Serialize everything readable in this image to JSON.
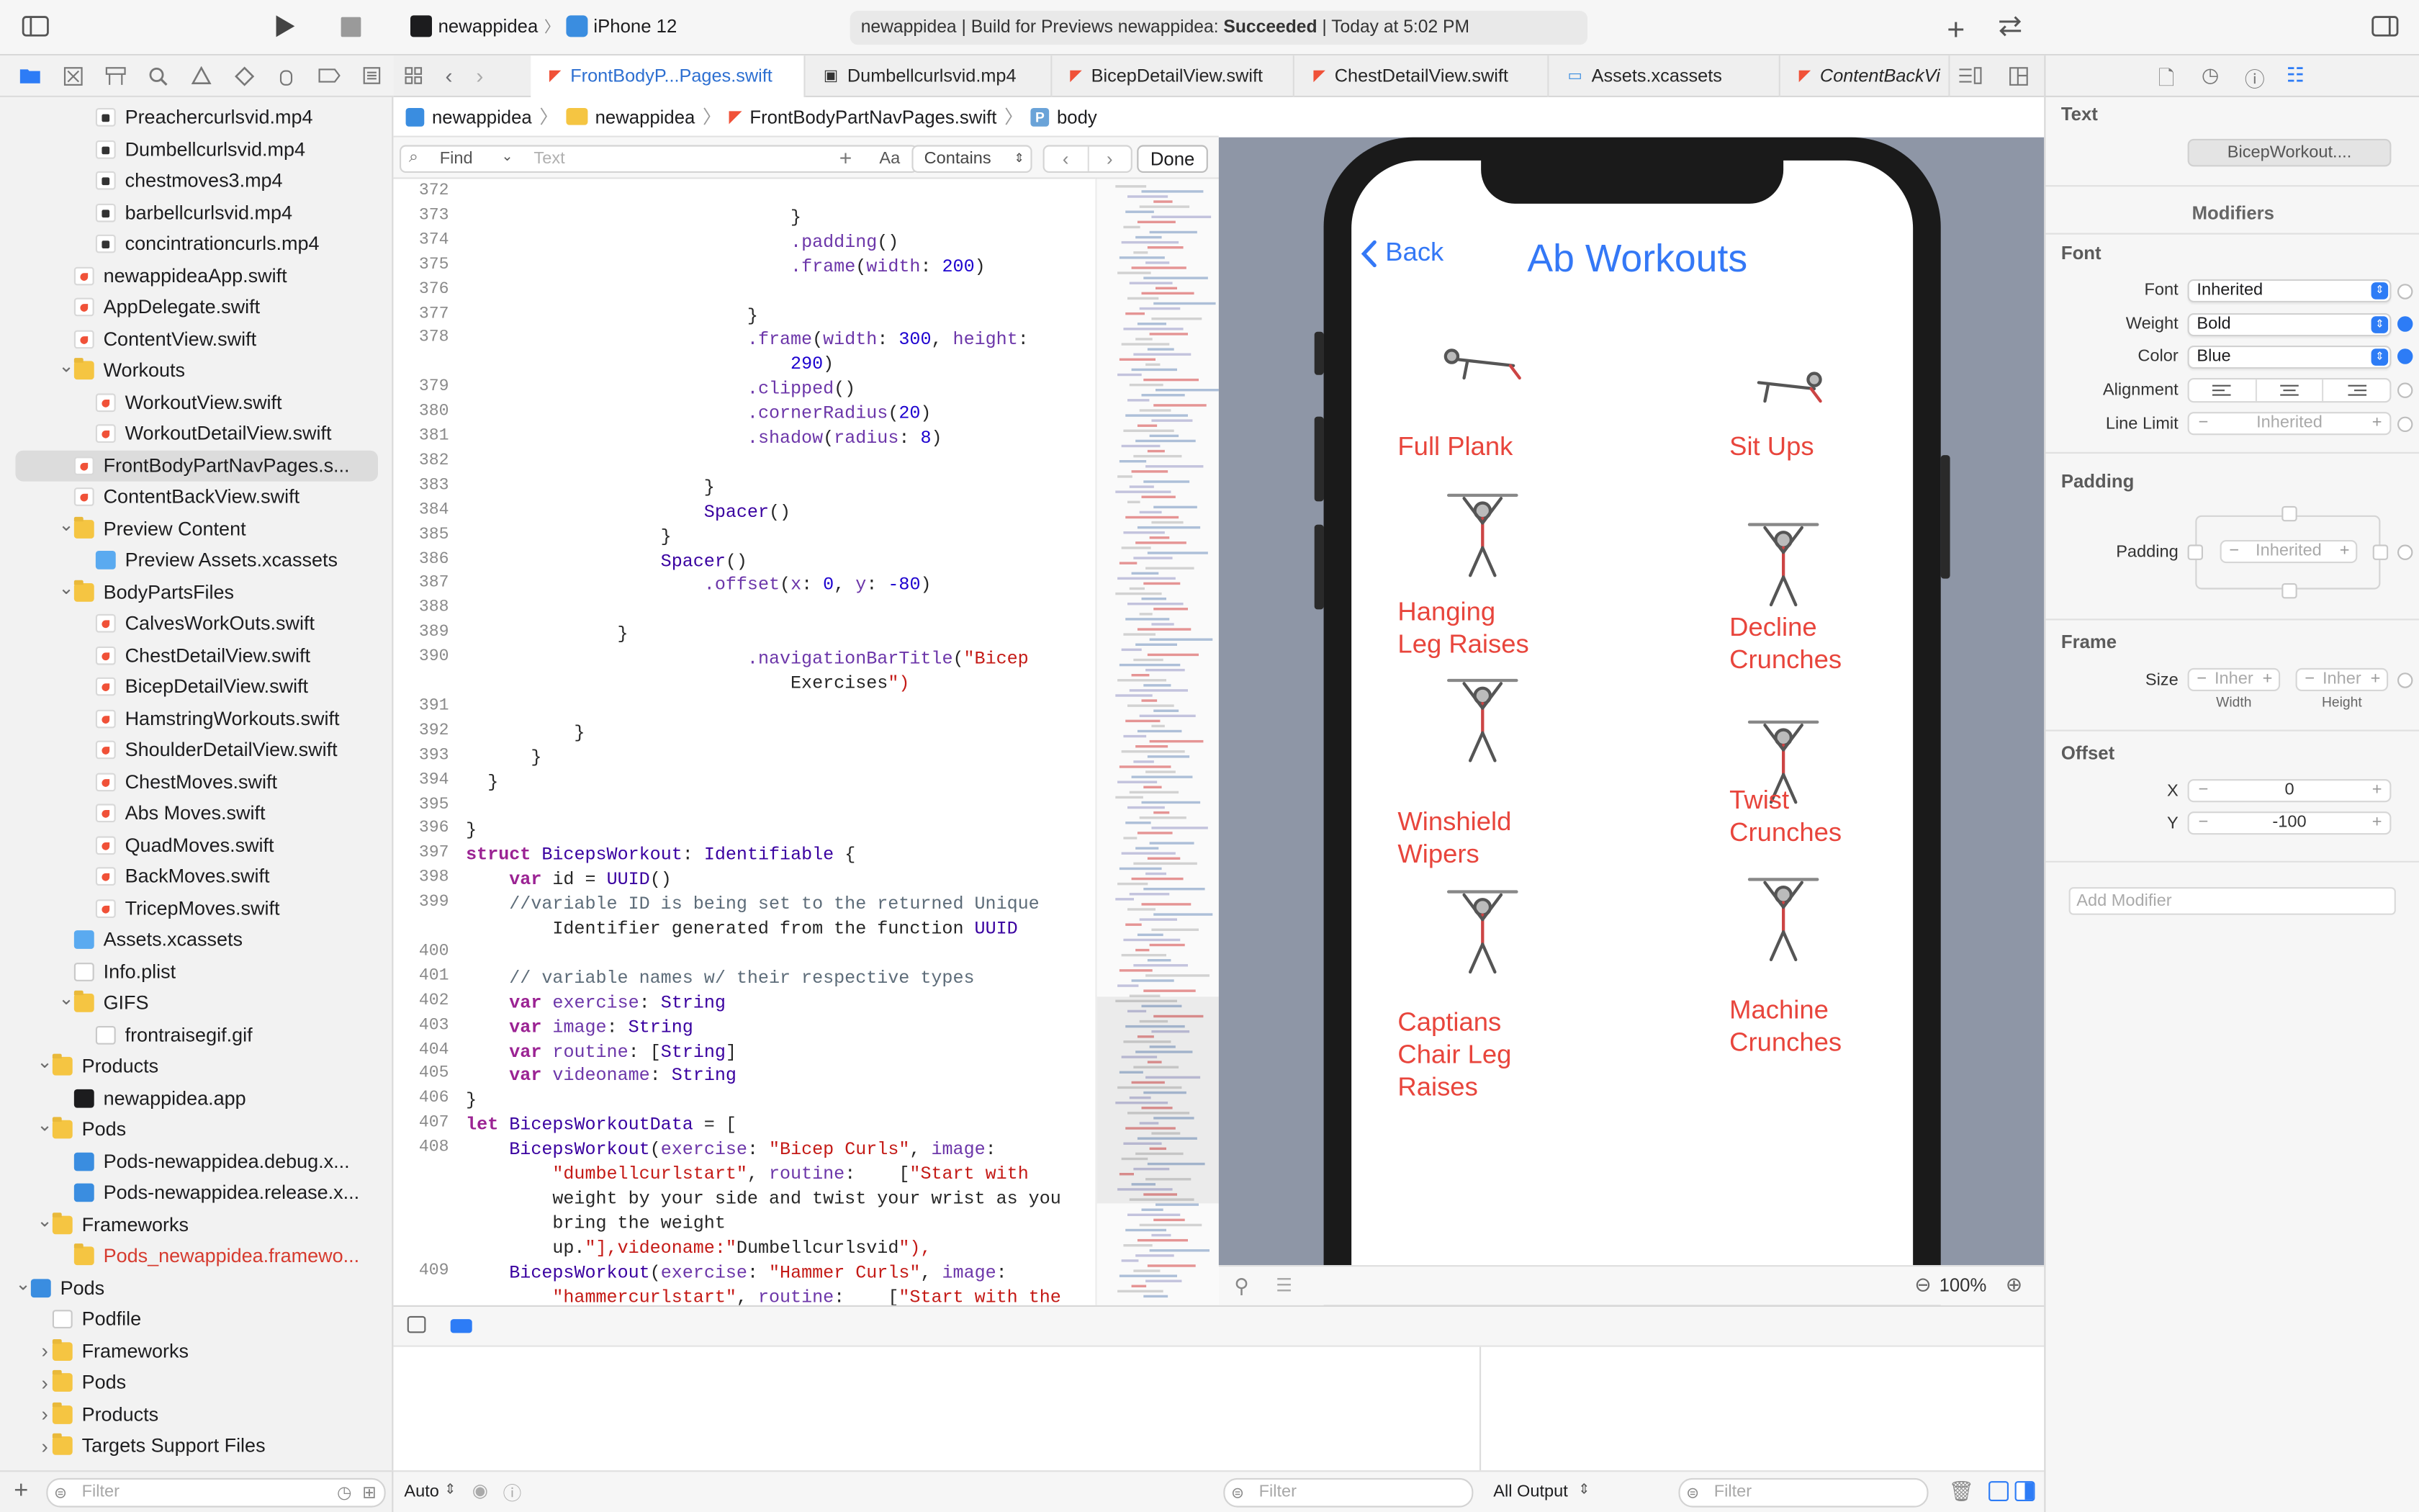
{
  "toolbar": {
    "scheme": "newappidea",
    "device": "iPhone 12",
    "status_prefix": "newappidea | Build for Previews newappidea: ",
    "status_bold": "Succeeded",
    "status_suffix": " | Today at 5:02 PM"
  },
  "tabs": [
    {
      "label": "FrontBodyP...Pages.swift",
      "active": true
    },
    {
      "label": "Dumbellcurlsvid.mp4"
    },
    {
      "label": "BicepDetailView.swift"
    },
    {
      "label": "ChestDetailView.swift"
    },
    {
      "label": "Assets.xcassets"
    },
    {
      "label": "ContentBackVi"
    }
  ],
  "navigator": [
    {
      "label": "Preachercurlsvid.mp4",
      "indent": 3,
      "icon": "vid"
    },
    {
      "label": "Dumbellcurlsvid.mp4",
      "indent": 3,
      "icon": "vid"
    },
    {
      "label": "chestmoves3.mp4",
      "indent": 3,
      "icon": "vid"
    },
    {
      "label": "barbellcurlsvid.mp4",
      "indent": 3,
      "icon": "vid"
    },
    {
      "label": "concintrationcurls.mp4",
      "indent": 3,
      "icon": "vid"
    },
    {
      "label": "newappideaApp.swift",
      "indent": 2,
      "icon": "swf"
    },
    {
      "label": "AppDelegate.swift",
      "indent": 2,
      "icon": "swf"
    },
    {
      "label": "ContentView.swift",
      "indent": 2,
      "icon": "swf"
    },
    {
      "label": "Workouts",
      "indent": 2,
      "icon": "fold",
      "disc": "open"
    },
    {
      "label": "WorkoutView.swift",
      "indent": 3,
      "icon": "swf"
    },
    {
      "label": "WorkoutDetailView.swift",
      "indent": 3,
      "icon": "swf"
    },
    {
      "label": "FrontBodyPartNavPages.s...",
      "indent": 2,
      "icon": "swf",
      "selected": true
    },
    {
      "label": "ContentBackView.swift",
      "indent": 2,
      "icon": "swf"
    },
    {
      "label": "Preview Content",
      "indent": 2,
      "icon": "fold",
      "disc": "open"
    },
    {
      "label": "Preview Assets.xcassets",
      "indent": 3,
      "icon": "asset"
    },
    {
      "label": "BodyPartsFiles",
      "indent": 2,
      "icon": "fold",
      "disc": "open"
    },
    {
      "label": "CalvesWorkOuts.swift",
      "indent": 3,
      "icon": "swf"
    },
    {
      "label": "ChestDetailView.swift",
      "indent": 3,
      "icon": "swf"
    },
    {
      "label": "BicepDetailView.swift",
      "indent": 3,
      "icon": "swf"
    },
    {
      "label": "HamstringWorkouts.swift",
      "indent": 3,
      "icon": "swf"
    },
    {
      "label": "ShoulderDetailView.swift",
      "indent": 3,
      "icon": "swf"
    },
    {
      "label": "ChestMoves.swift",
      "indent": 3,
      "icon": "swf"
    },
    {
      "label": "Abs Moves.swift",
      "indent": 3,
      "icon": "swf"
    },
    {
      "label": "QuadMoves.swift",
      "indent": 3,
      "icon": "swf"
    },
    {
      "label": "BackMoves.swift",
      "indent": 3,
      "icon": "swf"
    },
    {
      "label": "TricepMoves.swift",
      "indent": 3,
      "icon": "swf"
    },
    {
      "label": "Assets.xcassets",
      "indent": 2,
      "icon": "asset"
    },
    {
      "label": "Info.plist",
      "indent": 2,
      "icon": "plist"
    },
    {
      "label": "GIFS",
      "indent": 2,
      "icon": "fold",
      "disc": "open"
    },
    {
      "label": "frontraisegif.gif",
      "indent": 3,
      "icon": "plist"
    },
    {
      "label": "Products",
      "indent": 1,
      "icon": "fold",
      "disc": "open"
    },
    {
      "label": "newappidea.app",
      "indent": 2,
      "icon": "app"
    },
    {
      "label": "Pods",
      "indent": 1,
      "icon": "fold",
      "disc": "open"
    },
    {
      "label": "Pods-newappidea.debug.x...",
      "indent": 2,
      "icon": "xc"
    },
    {
      "label": "Pods-newappidea.release.x...",
      "indent": 2,
      "icon": "xc"
    },
    {
      "label": "Frameworks",
      "indent": 1,
      "icon": "fold",
      "disc": "open"
    },
    {
      "label": "Pods_newappidea.framewo...",
      "indent": 2,
      "icon": "fold",
      "red": true
    },
    {
      "label": "Pods",
      "indent": 0,
      "icon": "xc",
      "disc": "open"
    },
    {
      "label": "Podfile",
      "indent": 1,
      "icon": "plist"
    },
    {
      "label": "Frameworks",
      "indent": 1,
      "icon": "fold",
      "disc": "closed"
    },
    {
      "label": "Pods",
      "indent": 1,
      "icon": "fold",
      "disc": "closed"
    },
    {
      "label": "Products",
      "indent": 1,
      "icon": "fold",
      "disc": "closed"
    },
    {
      "label": "Targets Support Files",
      "indent": 1,
      "icon": "fold",
      "disc": "closed"
    }
  ],
  "nav_filter": "Filter",
  "jumpbar": [
    "newappidea",
    "newappidea",
    "FrontBodyPartNavPages.swift",
    "body"
  ],
  "find": {
    "mode": "Find",
    "placeholder": "Text",
    "case": "Aa",
    "match": "Contains",
    "done": "Done"
  },
  "code": [
    {
      "n": "372",
      "t": ""
    },
    {
      "n": "373",
      "t": "                              }"
    },
    {
      "n": "374",
      "t": "                              .padding()"
    },
    {
      "n": "375",
      "t": "                              .frame(width: 200)"
    },
    {
      "n": "376",
      "t": ""
    },
    {
      "n": "377",
      "t": "                          }"
    },
    {
      "n": "378",
      "t": "                          .frame(width: 300, height:"
    },
    {
      "n": "",
      "t": "                              290)"
    },
    {
      "n": "379",
      "t": "                          .clipped()"
    },
    {
      "n": "380",
      "t": "                          .cornerRadius(20)"
    },
    {
      "n": "381",
      "t": "                          .shadow(radius: 8)"
    },
    {
      "n": "382",
      "t": ""
    },
    {
      "n": "383",
      "t": "                      }"
    },
    {
      "n": "384",
      "t": "                      Spacer()"
    },
    {
      "n": "385",
      "t": "                  }"
    },
    {
      "n": "386",
      "t": "                  Spacer()"
    },
    {
      "n": "387",
      "t": "                      .offset(x: 0, y: -80)"
    },
    {
      "n": "388",
      "t": ""
    },
    {
      "n": "389",
      "t": "              }"
    },
    {
      "n": "390",
      "t": "                          .navigationBarTitle(\"Bicep"
    },
    {
      "n": "",
      "t": "                              Exercises\")"
    },
    {
      "n": "391",
      "t": ""
    },
    {
      "n": "392",
      "t": "          }"
    },
    {
      "n": "393",
      "t": "      }"
    },
    {
      "n": "394",
      "t": "  }"
    },
    {
      "n": "395",
      "t": ""
    },
    {
      "n": "396",
      "t": "}"
    },
    {
      "n": "397",
      "t": "struct BicepsWorkout: Identifiable {"
    },
    {
      "n": "398",
      "t": "    var id = UUID()"
    },
    {
      "n": "399",
      "t": "    //variable ID is being set to the returned Unique"
    },
    {
      "n": "",
      "t": "        Identifier generated from the function UUID"
    },
    {
      "n": "400",
      "t": ""
    },
    {
      "n": "401",
      "t": "    // variable names w/ their respective types"
    },
    {
      "n": "402",
      "t": "    var exercise: String"
    },
    {
      "n": "403",
      "t": "    var image: String"
    },
    {
      "n": "404",
      "t": "    var routine: [String]"
    },
    {
      "n": "405",
      "t": "    var videoname: String"
    },
    {
      "n": "406",
      "t": "}"
    },
    {
      "n": "407",
      "t": "let BicepsWorkoutData = ["
    },
    {
      "n": "408",
      "t": "    BicepsWorkout(exercise: \"Bicep Curls\", image:"
    },
    {
      "n": "",
      "t": "        \"dumbellcurlstart\", routine:    [\"Start with"
    },
    {
      "n": "",
      "t": "        weight by your side and twist your wrist as you"
    },
    {
      "n": "",
      "t": "        bring the weight"
    },
    {
      "n": "",
      "t": "        up.\"],videoname:\"Dumbellcurlsvid\"),"
    },
    {
      "n": "409",
      "t": "    BicepsWorkout(exercise: \"Hammer Curls\", image:"
    },
    {
      "n": "",
      "t": "        \"hammercurlstart\", routine:    [\"Start with the"
    }
  ],
  "preview": {
    "back": "Back",
    "title": "Ab Workouts",
    "exercises": [
      {
        "label": "Full Plank",
        "col": 0
      },
      {
        "label": "Sit Ups",
        "col": 1
      },
      {
        "label": "Hanging\nLeg Raises",
        "col": 0
      },
      {
        "label": "Decline\nCrunches",
        "col": 1
      },
      {
        "label": "Winshield\nWipers",
        "col": 0
      },
      {
        "label": "Twist\nCrunches",
        "col": 1
      },
      {
        "label": "Captians\nChair Leg\nRaises",
        "col": 0
      },
      {
        "label": "Machine\nCrunches",
        "col": 1
      }
    ],
    "zoom": "100%"
  },
  "debug": {
    "auto": "Auto",
    "filter": "Filter",
    "output": "All Output",
    "filter2": "Filter"
  },
  "inspector": {
    "text_section": "Text",
    "text_value": "BicepWorkout....",
    "modifiers": "Modifiers",
    "font_section": "Font",
    "font_label": "Font",
    "font_value": "Inherited",
    "weight_label": "Weight",
    "weight_value": "Bold",
    "color_label": "Color",
    "color_value": "Blue",
    "alignment_label": "Alignment",
    "linelimit_label": "Line Limit",
    "linelimit_value": "Inherited",
    "padding_section": "Padding",
    "padding_label": "Padding",
    "padding_value": "Inherited",
    "frame_section": "Frame",
    "size_label": "Size",
    "width_value": "Inher",
    "height_value": "Inher",
    "width_caption": "Width",
    "height_caption": "Height",
    "offset_section": "Offset",
    "x_label": "X",
    "x_value": "0",
    "y_label": "Y",
    "y_value": "-100",
    "add_modifier": "Add Modifier"
  },
  "colors": {
    "accent": "#2d7cf6",
    "preview_red": "#e8453c",
    "title_blue": "#3478f6"
  }
}
